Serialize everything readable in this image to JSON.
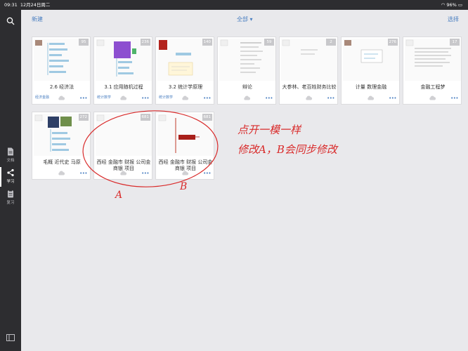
{
  "status_bar": {
    "time": "09:31",
    "date": "12月24日周二",
    "battery": "96%"
  },
  "sidebar": {
    "items": [
      {
        "label": "文档",
        "icon": "document-icon"
      },
      {
        "label": "学习",
        "icon": "share-icon"
      },
      {
        "label": "复习",
        "icon": "clipboard-icon"
      }
    ],
    "active": "学习"
  },
  "toolbar": {
    "new_label": "新建",
    "filter_label": "全部 ▾",
    "select_label": "选择"
  },
  "cards": [
    {
      "title": "2.6 经济法",
      "count": "95",
      "tag": "经济金融"
    },
    {
      "title": "3.1 应用随机过程",
      "count": "236",
      "tag": "统计数学"
    },
    {
      "title": "3.2 统计学原理",
      "count": "140",
      "tag": "统计数学"
    },
    {
      "title": "辩论",
      "count": "59",
      "tag": ""
    },
    {
      "title": "大参林、老百姓财务比较",
      "count": "2",
      "tag": ""
    },
    {
      "title": "计量 数理金融",
      "count": "276",
      "tag": ""
    },
    {
      "title": "金融工程梦",
      "count": "17",
      "tag": ""
    },
    {
      "title": "毛概 近代史 马原",
      "count": "272",
      "tag": ""
    },
    {
      "title": "西经 金融市 财报 公司金 商银 项目",
      "count": "681",
      "tag": ""
    },
    {
      "title": "西经 金融市 财报 公司金 商银 项目",
      "count": "681",
      "tag": ""
    }
  ],
  "annotation": {
    "line1": "点开一模一样",
    "line2": "修改A，B会同步修改",
    "label_a": "A",
    "label_b": "B"
  },
  "colors": {
    "accent": "#4a7fc1",
    "annotation": "#d92b2b",
    "sidebar_bg": "#2d2d30"
  }
}
